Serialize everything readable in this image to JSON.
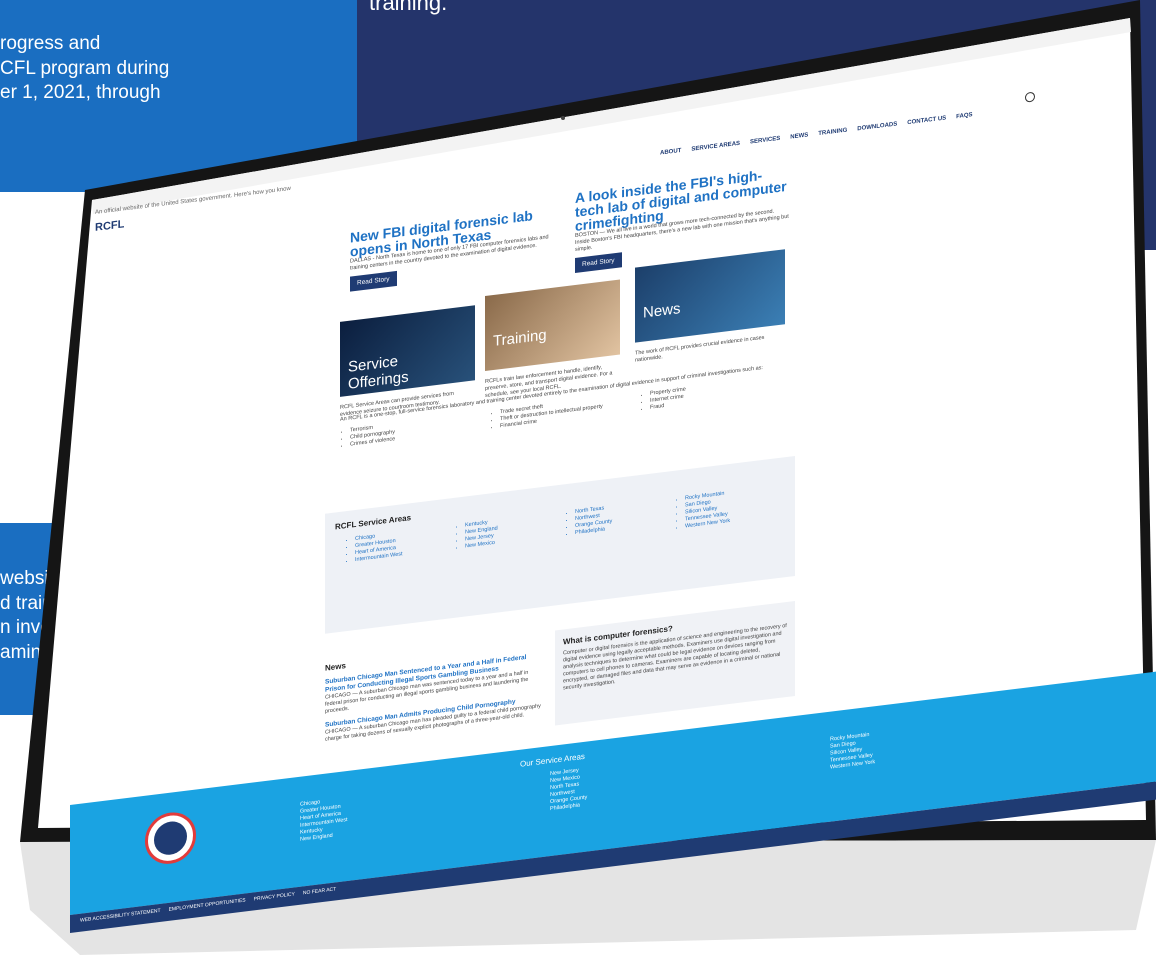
{
  "background": {
    "top_caption": "training.",
    "callout_1_lines": [
      "rogress and",
      "CFL program during",
      "er 1, 2021, through"
    ],
    "callout_2_lines": [
      "website. It provides",
      "d trainings offered",
      "n investigations",
      "aminers."
    ]
  },
  "site": {
    "gov_banner": "An official website of the United States government. Here's how you know",
    "logo_text": "RCFL",
    "nav": [
      "ABOUT",
      "SERVICE AREAS",
      "SERVICES",
      "NEWS",
      "TRAINING",
      "DOWNLOADS",
      "CONTACT US",
      "FAQS"
    ],
    "stories": [
      {
        "title": "New FBI digital forensic lab opens in North Texas",
        "text": "DALLAS - North Texas is home to one of only 17 FBI computer forensics labs and training centers in the country devoted to the examination of digital evidence.",
        "button": "Read Story"
      },
      {
        "title": "A look inside the FBI's high-tech lab of digital and computer crimefighting",
        "text": "BOSTON — We all live in a world that grows more tech-connected by the second. Inside Boston's FBI headquarters, there's a new lab with one mission that's anything but simple.",
        "button": "Read Story"
      }
    ],
    "tiles": [
      {
        "label_line1": "Service",
        "label_line2": "Offerings",
        "desc": "RCFL Service Areas can provide services from evidence seizure to courtroom testimony."
      },
      {
        "label_line1": "Training",
        "label_line2": "",
        "desc": "RCFLs train law enforcement to handle, identify, preserve, store, and transport digital evidence. For a schedule, see your local RCFL."
      },
      {
        "label_line1": "News",
        "label_line2": "",
        "desc": "The work of RCFL provides crucial evidence in cases nationwide."
      }
    ],
    "intro": "An RCFL is a one-stop, full-service forensics laboratory and training center devoted entirely to the examination of digital evidence in support of criminal investigations such as:",
    "crime_cols": [
      [
        "Terrorism",
        "Child pornography",
        "Crimes of violence"
      ],
      [
        "Trade secret theft",
        "Theft or destruction to intellectual property",
        "Financial crime"
      ],
      [
        "Property crime",
        "Internet crime",
        "Fraud"
      ]
    ],
    "service_areas_title": "RCFL Service Areas",
    "service_areas": [
      [
        "Chicago",
        "Greater Houston",
        "Heart of America",
        "Intermountain West"
      ],
      [
        "Kentucky",
        "New England",
        "New Jersey",
        "New Mexico"
      ],
      [
        "North Texas",
        "Northwest",
        "Orange County",
        "Philadelphia"
      ],
      [
        "Rocky Mountain",
        "San Diego",
        "Silicon Valley",
        "Tennessee Valley",
        "Western New York"
      ]
    ],
    "news": {
      "title": "News",
      "items": [
        {
          "headline": "Suburban Chicago Man Sentenced to a Year and a Half in Federal Prison for Conducting Illegal Sports Gambling Business",
          "text": "CHICAGO — A suburban Chicago man was sentenced today to a year and a half in federal prison for conducting an illegal sports gambling business and laundering the proceeds."
        },
        {
          "headline": "Suburban Chicago Man Admits Producing Child Pornography",
          "text": "CHICAGO — A suburban Chicago man has pleaded guilty to a federal child pornography charge for taking dozens of sexually explicit photographs of a three-year-old child."
        }
      ]
    },
    "what": {
      "title": "What is computer forensics?",
      "text": "Computer or digital forensics is the application of science and engineering to the recovery of digital evidence using legally acceptable methods. Examiners use digital investigation and analysis techniques to determine what could be legal evidence on devices ranging from computers to cell phones to cameras. Examiners are capable of locating deleted, encrypted, or damaged files and data that may serve as evidence in a criminal or national security investigation."
    },
    "footer": {
      "title": "Our Service Areas",
      "cols": [
        [
          "Chicago",
          "Greater Houston",
          "Heart of America",
          "Intermountain West",
          "Kentucky",
          "New England"
        ],
        [
          "New Jersey",
          "New Mexico",
          "North Texas",
          "Northwest",
          "Orange County",
          "Philadelphia"
        ],
        [
          "Rocky Mountain",
          "San Diego",
          "Silicon Valley",
          "Tennessee Valley",
          "Western New York"
        ]
      ],
      "links": [
        "WEB ACCESSIBILITY STATEMENT",
        "EMPLOYMENT OPPORTUNITIES",
        "PRIVACY POLICY",
        "NO FEAR ACT"
      ]
    }
  },
  "colors": {
    "navy": "#24346b",
    "callout_blue": "#1a6ec1",
    "footer_blue": "#1aa3e2",
    "link_blue": "#1f72c4"
  }
}
